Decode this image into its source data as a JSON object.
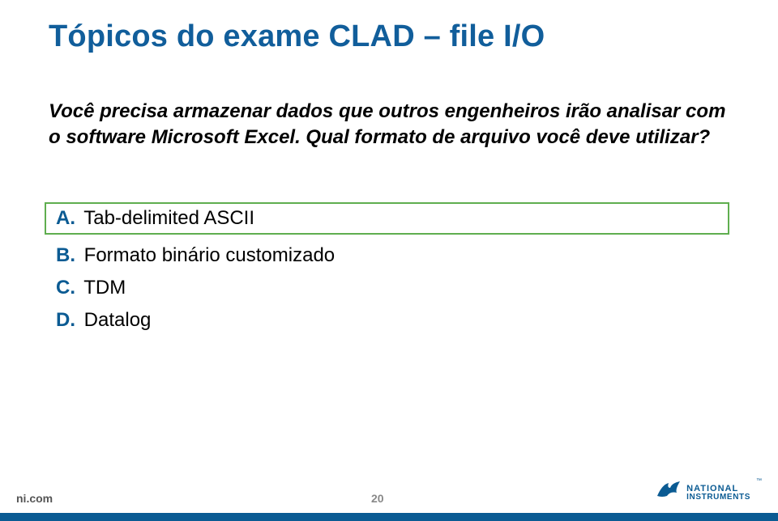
{
  "title": "Tópicos do exame CLAD – file I/O",
  "question": "Você precisa armazenar dados que outros engenheiros irão analisar com o software Microsoft Excel. Qual formato de arquivo você deve utilizar?",
  "answers": [
    {
      "letter": "A.",
      "text": "Tab-delimited ASCII",
      "correct": true
    },
    {
      "letter": "B.",
      "text": "Formato binário customizado",
      "correct": false
    },
    {
      "letter": "C.",
      "text": "TDM",
      "correct": false
    },
    {
      "letter": "D.",
      "text": "Datalog",
      "correct": false
    }
  ],
  "footer": {
    "link": "ni.com",
    "page": "20",
    "logo_top": "NATIONAL",
    "logo_bottom": "INSTRUMENTS"
  }
}
